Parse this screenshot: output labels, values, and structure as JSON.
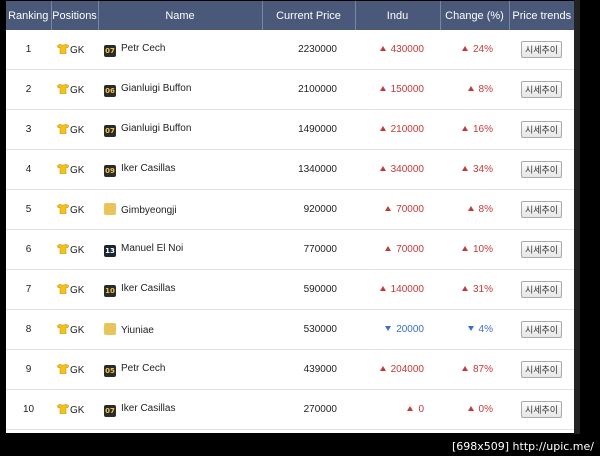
{
  "headers": {
    "ranking": "Ranking",
    "positions": "Positions",
    "name": "Name",
    "current_price": "Current Price",
    "indu": "Indu",
    "change": "Change (%)",
    "price_trends": "Price trends"
  },
  "trend_button_label": "시세추이",
  "rows": [
    {
      "rank": "1",
      "position": "GK",
      "badge": "07",
      "name": "Petr Cech",
      "price": "2230000",
      "indu": "430000",
      "change": "24%",
      "direction": "up"
    },
    {
      "rank": "2",
      "position": "GK",
      "badge": "06",
      "name": "Gianluigi Buffon",
      "price": "2100000",
      "indu": "150000",
      "change": "8%",
      "direction": "up"
    },
    {
      "rank": "3",
      "position": "GK",
      "badge": "07",
      "name": "Gianluigi Buffon",
      "price": "1490000",
      "indu": "210000",
      "change": "16%",
      "direction": "up"
    },
    {
      "rank": "4",
      "position": "GK",
      "badge": "09",
      "name": "Iker Casillas",
      "price": "1340000",
      "indu": "340000",
      "change": "34%",
      "direction": "up"
    },
    {
      "rank": "5",
      "position": "GK",
      "badge": "",
      "name": "Gimbyeongji",
      "price": "920000",
      "indu": "70000",
      "change": "8%",
      "direction": "up"
    },
    {
      "rank": "6",
      "position": "GK",
      "badge": "13",
      "name": "Manuel El Noi",
      "price": "770000",
      "indu": "70000",
      "change": "10%",
      "direction": "up"
    },
    {
      "rank": "7",
      "position": "GK",
      "badge": "10",
      "name": "Iker Casillas",
      "price": "590000",
      "indu": "140000",
      "change": "31%",
      "direction": "up"
    },
    {
      "rank": "8",
      "position": "GK",
      "badge": "",
      "name": "Yiuniae",
      "price": "530000",
      "indu": "20000",
      "change": "4%",
      "direction": "down"
    },
    {
      "rank": "9",
      "position": "GK",
      "badge": "05",
      "name": "Petr Cech",
      "price": "439000",
      "indu": "204000",
      "change": "87%",
      "direction": "up"
    },
    {
      "rank": "10",
      "position": "GK",
      "badge": "07",
      "name": "Iker Casillas",
      "price": "270000",
      "indu": "0",
      "change": "0%",
      "direction": "up"
    }
  ],
  "watermark": "[698x509] http://upic.me/",
  "colors": {
    "header": "#4a5879",
    "up": "#c23a3a",
    "down": "#3b6fc9",
    "shirt": "#f2c21b"
  }
}
